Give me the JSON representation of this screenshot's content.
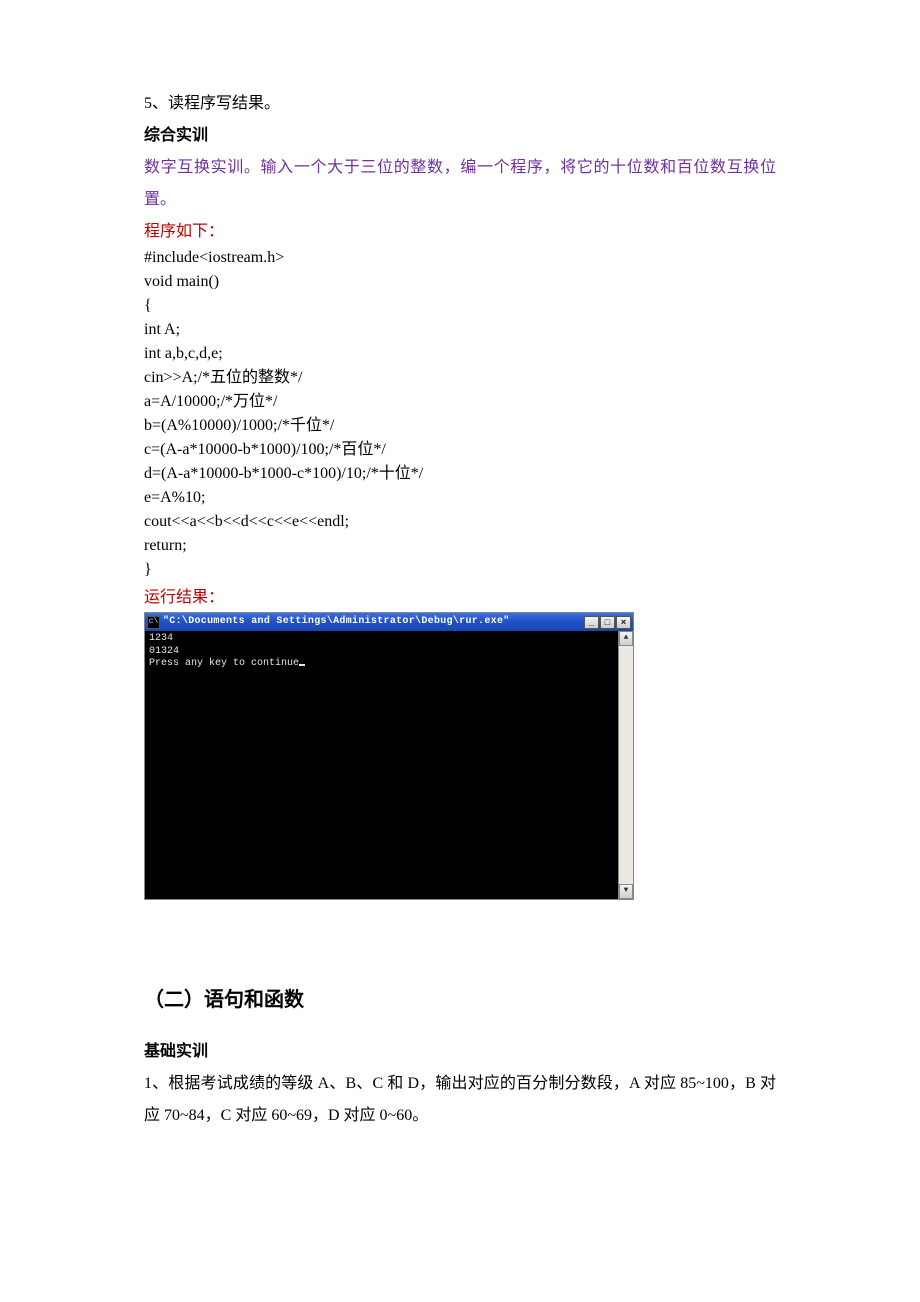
{
  "top": {
    "item5": "5、读程序写结果。",
    "h1": "综合实训",
    "desc": "数字互换实训。输入一个大于三位的整数，编一个程序，将它的十位数和百位数互换位置。",
    "code_label": "程序如下：",
    "code": "#include<iostream.h>\nvoid main()\n{\nint A;\nint a,b,c,d,e;\ncin>>A;/*五位的整数*/\na=A/10000;/*万位*/\nb=(A%10000)/1000;/*千位*/\nc=(A-a*10000-b*1000)/100;/*百位*/\nd=(A-a*10000-b*1000-c*100)/10;/*十位*/\ne=A%10;\ncout<<a<<b<<d<<c<<e<<endl;\nreturn;\n}",
    "run_label": "运行结果："
  },
  "console": {
    "icon": "c\\",
    "title": "\"C:\\Documents and Settings\\Administrator\\Debug\\rur.exe\"",
    "lines": [
      "1234",
      "01324",
      "Press any key to continue"
    ],
    "btn_min": "_",
    "btn_max": "□",
    "btn_close": "×",
    "arrow_up": "▲",
    "arrow_down": "▼"
  },
  "section2": {
    "title": "（二）语句和函数",
    "h1": "基础实训",
    "q1": "1、根据考试成绩的等级 A、B、C 和 D，输出对应的百分制分数段，A 对应 85~100，B 对应 70~84，C 对应 60~69，D 对应 0~60。"
  }
}
